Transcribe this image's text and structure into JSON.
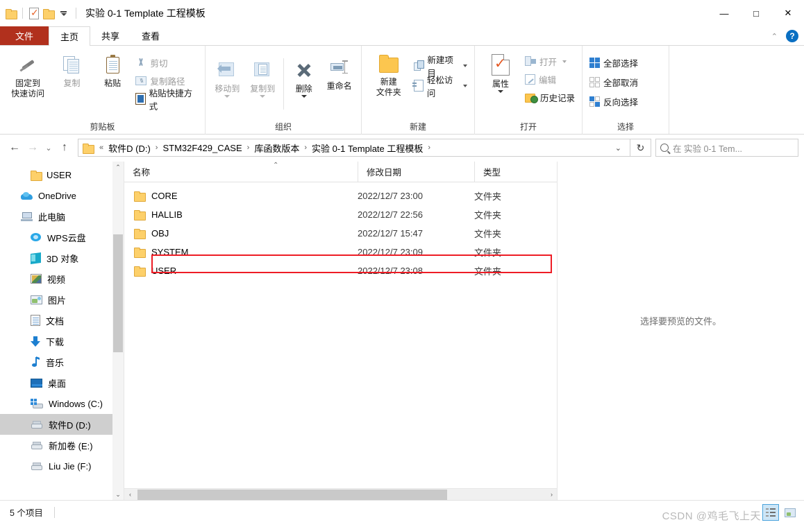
{
  "window": {
    "title": "实验 0-1 Template 工程模板",
    "quick_access": [
      "folder-icon",
      "properties-icon",
      "folder-icon",
      "dropdown-icon"
    ],
    "controls": {
      "minimize": "—",
      "maximize": "□",
      "close": "✕"
    }
  },
  "tabs": {
    "file": "文件",
    "items": [
      {
        "label": "主页",
        "active": true
      },
      {
        "label": "共享",
        "active": false
      },
      {
        "label": "查看",
        "active": false
      }
    ],
    "collapse_ribbon": "⌃",
    "help": "?"
  },
  "ribbon": {
    "groups": [
      {
        "label": "剪贴板",
        "big": [
          {
            "label": "固定到\n快速访问",
            "line1": "固定到",
            "line2": "快速访问",
            "icon": "pin-icon",
            "dim": false
          },
          {
            "label": "复制",
            "icon": "copy-icon",
            "dim": true
          },
          {
            "label": "粘贴",
            "icon": "paste-icon",
            "dim": false
          }
        ],
        "small": [
          {
            "label": "剪切",
            "icon": "scissors-icon",
            "dim": true
          },
          {
            "label": "复制路径",
            "icon": "copy-path-icon",
            "dim": true
          },
          {
            "label": "粘贴快捷方式",
            "icon": "paste-shortcut-icon",
            "dim": false
          }
        ]
      },
      {
        "label": "组织",
        "big": [
          {
            "label": "移动到",
            "icon": "move-to-icon",
            "dim": true,
            "caret": true
          },
          {
            "label": "复制到",
            "icon": "copy-to-icon",
            "dim": true,
            "caret": true
          },
          {
            "label": "删除",
            "icon": "delete-icon",
            "dim": false,
            "caret": true
          },
          {
            "label": "重命名",
            "icon": "rename-icon",
            "dim": false
          }
        ]
      },
      {
        "label": "新建",
        "big": [
          {
            "label": "新建\n文件夹",
            "line1": "新建",
            "line2": "文件夹",
            "icon": "new-folder-icon",
            "dim": false
          }
        ],
        "small": [
          {
            "label": "新建项目",
            "icon": "new-item-icon",
            "dim": false,
            "caret": true
          },
          {
            "label": "轻松访问",
            "icon": "easy-access-icon",
            "dim": false,
            "caret": true
          }
        ]
      },
      {
        "label": "打开",
        "big": [
          {
            "label": "属性",
            "icon": "properties-icon",
            "dim": false,
            "caret": true
          }
        ],
        "small": [
          {
            "label": "打开",
            "icon": "open-icon",
            "dim": true,
            "caret": true
          },
          {
            "label": "编辑",
            "icon": "edit-icon",
            "dim": true
          },
          {
            "label": "历史记录",
            "icon": "history-icon",
            "dim": false
          }
        ]
      },
      {
        "label": "选择",
        "small": [
          {
            "label": "全部选择",
            "icon": "select-all-icon",
            "dim": false
          },
          {
            "label": "全部取消",
            "icon": "select-none-icon",
            "dim": false
          },
          {
            "label": "反向选择",
            "icon": "invert-selection-icon",
            "dim": false
          }
        ]
      }
    ]
  },
  "address": {
    "back": "←",
    "forward": "→",
    "recent": "⌄",
    "up": "↑",
    "breadcrumb_prefix": "«",
    "crumbs": [
      "软件D (D:)",
      "STM32F429_CASE",
      "库函数版本",
      "实验 0-1 Template 工程模板"
    ],
    "separator": "›",
    "dropdown": "⌄",
    "refresh": "↻",
    "search_placeholder": "在 实验 0-1 Tem..."
  },
  "sidebar": {
    "items": [
      {
        "label": "USER",
        "icon": "folder-icon",
        "indent": 1,
        "selected": false
      },
      {
        "label": "OneDrive",
        "icon": "onedrive-icon",
        "indent": 0,
        "selected": false
      },
      {
        "label": "此电脑",
        "icon": "this-pc-icon",
        "indent": 0,
        "selected": false
      },
      {
        "label": "WPS云盘",
        "icon": "wps-cloud-icon",
        "indent": 1,
        "selected": false
      },
      {
        "label": "3D 对象",
        "icon": "3d-objects-icon",
        "indent": 1,
        "selected": false
      },
      {
        "label": "视频",
        "icon": "videos-icon",
        "indent": 1,
        "selected": false
      },
      {
        "label": "图片",
        "icon": "pictures-icon",
        "indent": 1,
        "selected": false
      },
      {
        "label": "文档",
        "icon": "documents-icon",
        "indent": 1,
        "selected": false
      },
      {
        "label": "下载",
        "icon": "downloads-icon",
        "indent": 1,
        "selected": false
      },
      {
        "label": "音乐",
        "icon": "music-icon",
        "indent": 1,
        "selected": false
      },
      {
        "label": "桌面",
        "icon": "desktop-icon",
        "indent": 1,
        "selected": false
      },
      {
        "label": "Windows (C:)",
        "icon": "windows-drive-icon",
        "indent": 1,
        "selected": false
      },
      {
        "label": "软件D (D:)",
        "icon": "drive-icon",
        "indent": 1,
        "selected": true
      },
      {
        "label": "新加卷 (E:)",
        "icon": "drive-icon",
        "indent": 1,
        "selected": false
      },
      {
        "label": "Liu Jie  (F:)",
        "icon": "drive-icon",
        "indent": 1,
        "selected": false
      }
    ],
    "scroll_up": "⌃",
    "scroll_down": "⌄"
  },
  "filelist": {
    "columns": [
      "名称",
      "修改日期",
      "类型"
    ],
    "sort_indicator": "⌃",
    "rows": [
      {
        "name": "CORE",
        "date": "2022/12/7 23:00",
        "type": "文件夹",
        "highlighted": false
      },
      {
        "name": "HALLIB",
        "date": "2022/12/7 22:56",
        "type": "文件夹",
        "highlighted": false
      },
      {
        "name": "OBJ",
        "date": "2022/12/7 15:47",
        "type": "文件夹",
        "highlighted": false
      },
      {
        "name": "SYSTEM",
        "date": "2022/12/7 23:09",
        "type": "文件夹",
        "highlighted": true
      },
      {
        "name": "USER",
        "date": "2022/12/7 23:08",
        "type": "文件夹",
        "highlighted": false
      }
    ],
    "hscroll_left": "‹",
    "hscroll_right": "›"
  },
  "preview": {
    "message": "选择要预览的文件。"
  },
  "statusbar": {
    "item_count": "5 个项目",
    "view_details": "details-view-icon",
    "view_large_icons": "large-icons-view-icon"
  },
  "watermark": "CSDN @鸡毛飞上天",
  "colors": {
    "file_tab": "#b1301d",
    "accent": "#2f7fd0",
    "highlight_box": "#ee1c25",
    "selection": "#cfcfcf",
    "folder": "#fcc64f"
  }
}
